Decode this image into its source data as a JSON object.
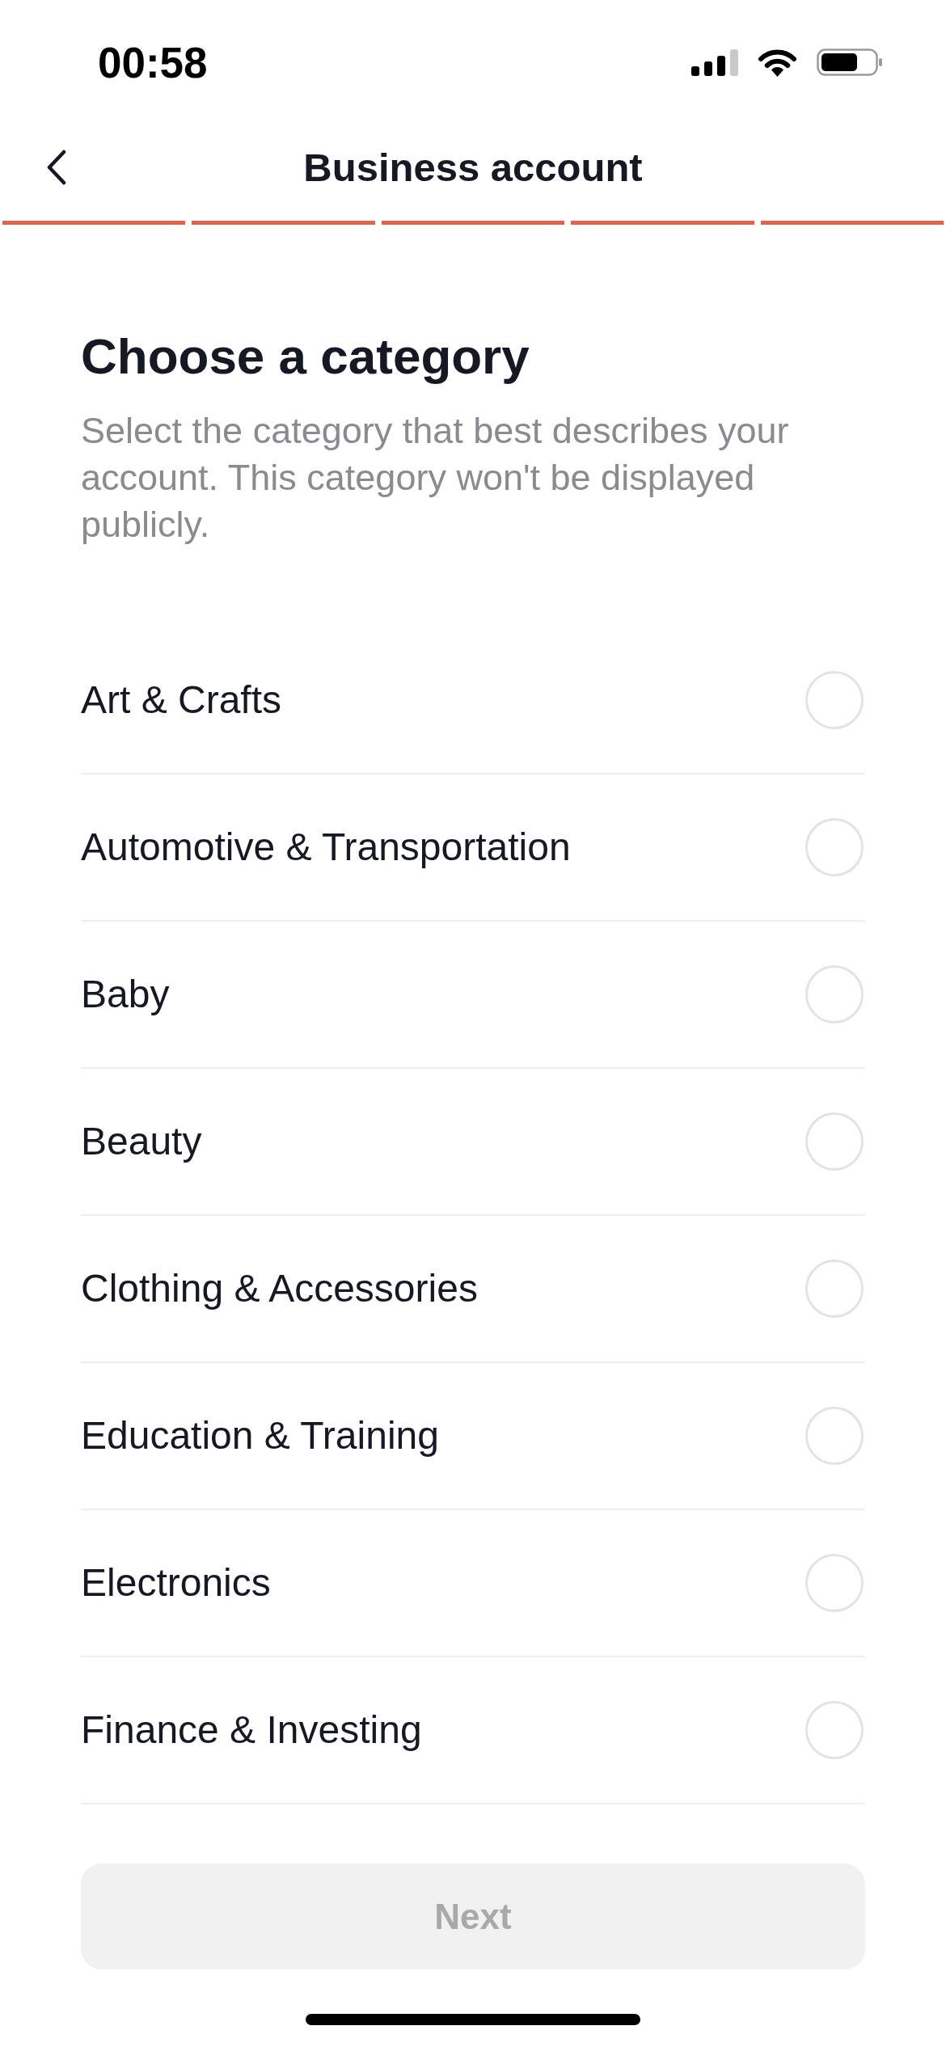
{
  "status_bar": {
    "time": "00:58"
  },
  "nav": {
    "title": "Business account"
  },
  "progress": {
    "steps": [
      {
        "completed": true
      },
      {
        "completed": true
      },
      {
        "completed": true
      },
      {
        "completed": true
      },
      {
        "completed": true
      }
    ]
  },
  "heading": "Choose a category",
  "description": "Select the category that best describes your account. This category won't be displayed publicly.",
  "categories": [
    {
      "label": "Art & Crafts",
      "selected": false
    },
    {
      "label": "Automotive & Transportation",
      "selected": false
    },
    {
      "label": "Baby",
      "selected": false
    },
    {
      "label": "Beauty",
      "selected": false
    },
    {
      "label": "Clothing & Accessories",
      "selected": false
    },
    {
      "label": "Education & Training",
      "selected": false
    },
    {
      "label": "Electronics",
      "selected": false
    },
    {
      "label": "Finance & Investing",
      "selected": false
    }
  ],
  "next_button": {
    "label": "Next",
    "disabled": true
  }
}
